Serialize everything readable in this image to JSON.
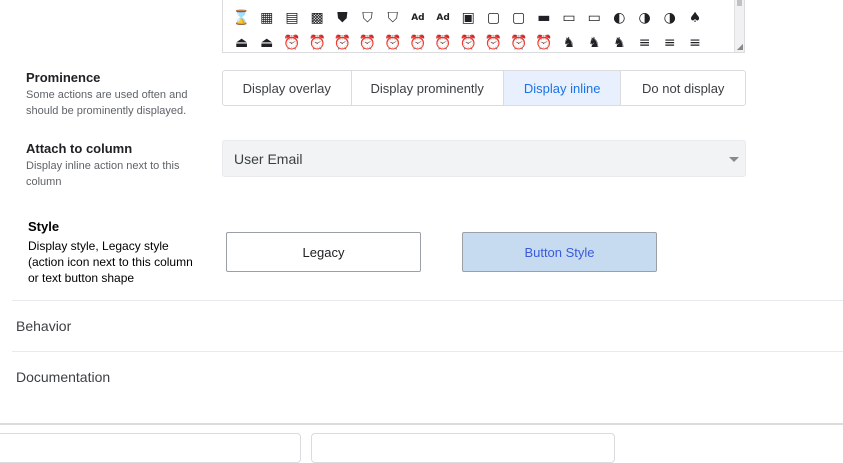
{
  "icons": {
    "row1": [
      "⌛",
      "▦",
      "▤",
      "▩",
      "⛊",
      "⛉",
      "⛉",
      "Ad",
      "Ad",
      "▣",
      "▢",
      "▢",
      "▬",
      "▭",
      "▭",
      "◐",
      "◑",
      "◑",
      "♠"
    ],
    "row2": [
      "⏏",
      "⏏",
      "⏰",
      "⏰",
      "⏰",
      "⏰",
      "⏰",
      "⏰",
      "⏰",
      "⏰",
      "⏰",
      "⏰",
      "⏰",
      "♞",
      "♞",
      "♞",
      "≡",
      "≡",
      "≡"
    ]
  },
  "prominence": {
    "title": "Prominence",
    "description": "Some actions are used often and should be prominently displayed.",
    "options": [
      "Display overlay",
      "Display prominently",
      "Display inline",
      "Do not display"
    ],
    "selected": "Display inline"
  },
  "attach": {
    "title": "Attach to column",
    "description": "Display inline action next to this column",
    "value": "User Email"
  },
  "style": {
    "title": "Style",
    "description": "Display style, Legacy style (action icon next to this column or text button shape",
    "legacy_label": "Legacy",
    "button_label": "Button Style",
    "selected": "Button Style"
  },
  "sections": {
    "behavior": "Behavior",
    "documentation": "Documentation"
  },
  "colors": {
    "accent": "#1a73e8",
    "selected_bg": "#e8f0fe",
    "button_style_bg": "#c6dbef"
  }
}
